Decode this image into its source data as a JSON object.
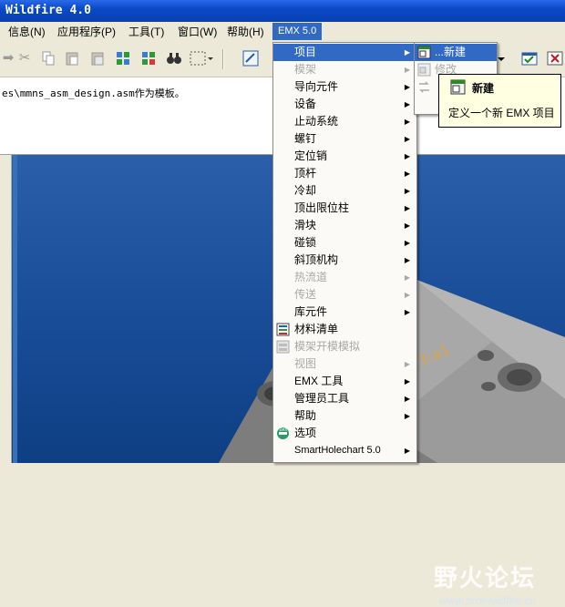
{
  "window": {
    "title": "Wildfire 4.0"
  },
  "menubar": {
    "items": [
      {
        "label": "信息(N)"
      },
      {
        "label": "应用程序(P)"
      },
      {
        "label": "工具(T)"
      },
      {
        "label": "窗口(W)"
      },
      {
        "label": "帮助(H)"
      },
      {
        "label": "EMX 5.0"
      }
    ]
  },
  "message": {
    "text": "es\\mmns_asm_design.asm作为模板。"
  },
  "emx_menu": {
    "items": [
      {
        "label": "项目",
        "has_submenu": true,
        "disabled": false,
        "highlighted": true
      },
      {
        "label": "模架",
        "has_submenu": true,
        "disabled": true
      },
      {
        "label": "导向元件",
        "has_submenu": true,
        "disabled": false
      },
      {
        "label": "设备",
        "has_submenu": true,
        "disabled": false
      },
      {
        "label": "止动系统",
        "has_submenu": true,
        "disabled": false
      },
      {
        "label": "螺钉",
        "has_submenu": true,
        "disabled": false
      },
      {
        "label": "定位销",
        "has_submenu": true,
        "disabled": false
      },
      {
        "label": "顶杆",
        "has_submenu": true,
        "disabled": false
      },
      {
        "label": "冷却",
        "has_submenu": true,
        "disabled": false
      },
      {
        "label": "顶出限位柱",
        "has_submenu": true,
        "disabled": false
      },
      {
        "label": "滑块",
        "has_submenu": true,
        "disabled": false
      },
      {
        "label": "碰锁",
        "has_submenu": true,
        "disabled": false
      },
      {
        "label": "斜顶机构",
        "has_submenu": true,
        "disabled": false
      },
      {
        "label": "热流道",
        "has_submenu": true,
        "disabled": true
      },
      {
        "label": "传送",
        "has_submenu": true,
        "disabled": true
      },
      {
        "label": "库元件",
        "has_submenu": true,
        "disabled": false
      },
      {
        "label": "材料清单",
        "has_submenu": false,
        "disabled": false,
        "icon": "bom-icon"
      },
      {
        "label": "模架开模模拟",
        "has_submenu": false,
        "disabled": true,
        "icon": "simulation-icon"
      },
      {
        "label": "视图",
        "has_submenu": true,
        "disabled": true
      },
      {
        "label": "EMX 工具",
        "has_submenu": true,
        "disabled": false
      },
      {
        "label": "管理员工具",
        "has_submenu": true,
        "disabled": false
      },
      {
        "label": "帮助",
        "has_submenu": true,
        "disabled": false
      },
      {
        "label": "选项",
        "has_submenu": false,
        "disabled": false,
        "icon": "options-icon"
      },
      {
        "label": "SmartHolechart 5.0",
        "has_submenu": true,
        "disabled": false
      }
    ]
  },
  "project_submenu": {
    "items": [
      {
        "label": "...新建",
        "highlighted": true,
        "disabled": false
      },
      {
        "label": "修改",
        "disabled": true
      },
      {
        "label": "",
        "disabled": true
      }
    ]
  },
  "tooltip": {
    "title": "新建",
    "description": "定义一个新 EMX 项目"
  },
  "watermark": {
    "text": "野火论坛",
    "url": "www.proewildfire.cn"
  },
  "colors": {
    "highlight": "#316ac5",
    "titlebar": "#0a49c8",
    "graphics_bg": "#1a4f9a"
  }
}
